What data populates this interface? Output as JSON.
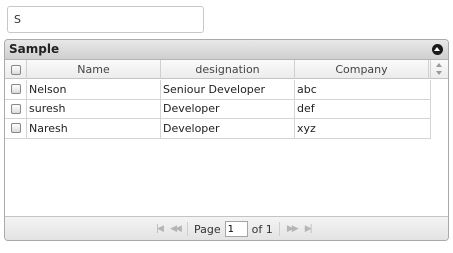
{
  "search": {
    "value": "S"
  },
  "grid": {
    "caption": "Sample",
    "columns": [
      "Name",
      "designation",
      "Company"
    ],
    "rows": [
      {
        "name": "Nelson",
        "designation": "Seniour Developer",
        "company": "abc"
      },
      {
        "name": "suresh",
        "designation": "Developer",
        "company": "def"
      },
      {
        "name": "Naresh",
        "designation": "Developer",
        "company": "xyz"
      }
    ]
  },
  "pager": {
    "page_label": "Page",
    "page_value": "1",
    "of_label": "of 1",
    "first_icon": "first-page-icon",
    "prev_icon": "prev-page-icon",
    "next_icon": "next-page-icon",
    "last_icon": "last-page-icon"
  }
}
